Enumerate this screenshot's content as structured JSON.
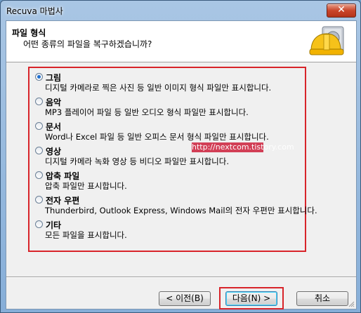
{
  "window": {
    "title": "Recuva 마법사",
    "close_glyph": "✕"
  },
  "header": {
    "title": "파일 형식",
    "subtitle": "어떤 종류의 파일을 복구하겠습니까?",
    "icon": "recuva-hardhat-drive-icon"
  },
  "options": [
    {
      "title": "그림",
      "description": "디지털 카메라로 찍은 사진 등 일반 이미지 형식 파일만 표시합니다.",
      "selected": true
    },
    {
      "title": "음악",
      "description": "MP3 플레이어 파일 등 일반 오디오 형식 파일만 표시합니다.",
      "selected": false
    },
    {
      "title": "문서",
      "description": "Word나 Excel 파일 등 일반 오피스 문서 형식 파일만 표시합니다.",
      "selected": false
    },
    {
      "title": "영상",
      "description": "디지털 카메라 녹화 영상 등 비디오 파일만 표시합니다.",
      "selected": false
    },
    {
      "title": "압축 파일",
      "description": "압축 파일만 표시합니다.",
      "selected": false
    },
    {
      "title": "전자 우편",
      "description": "Thunderbird, Outlook Express, Windows Mail의 전자 우편만 표시합니다.",
      "selected": false
    },
    {
      "title": "기타",
      "description": "모든 파일을 표시합니다.",
      "selected": false
    }
  ],
  "watermark": "http://nextcom.tistory.com",
  "buttons": {
    "back": "< 이전(B)",
    "next": "다음(N) >",
    "cancel": "취소"
  },
  "colors": {
    "highlight_red": "#d8242a",
    "selected_radio": "#1e6fd0"
  }
}
